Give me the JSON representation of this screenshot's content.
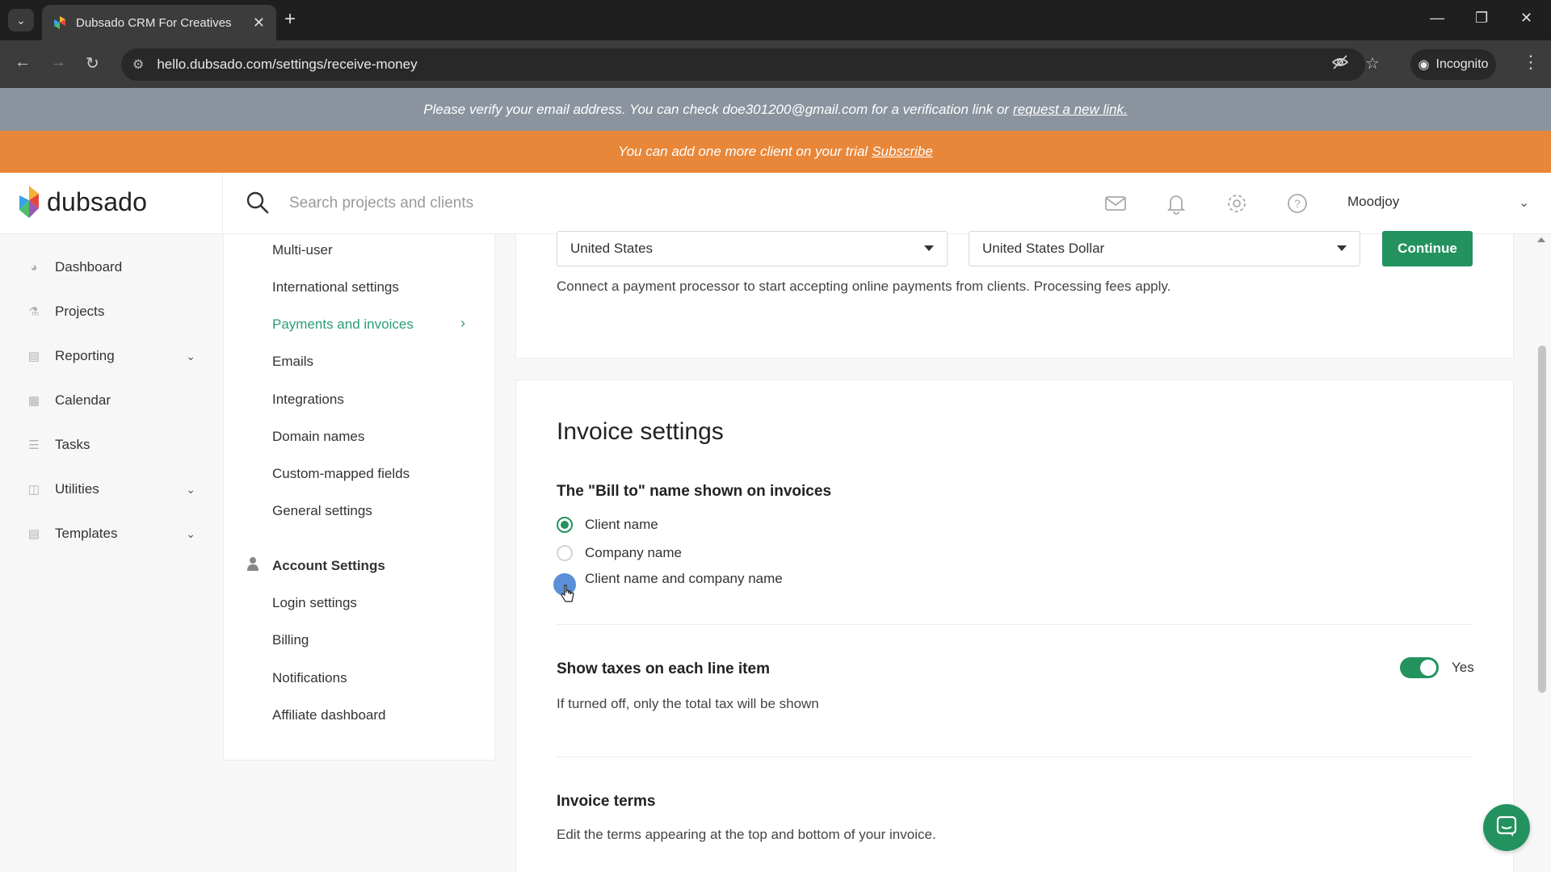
{
  "browser": {
    "tab_title": "Dubsado CRM For Creatives",
    "url": "hello.dubsado.com/settings/receive-money",
    "incognito_label": "Incognito"
  },
  "banners": {
    "verify_text": "Please verify your email address. You can check doe301200@gmail.com for a verification link or",
    "verify_link": "request a new link.",
    "trial_text": "You can add one more client on your trial",
    "trial_link": "Subscribe"
  },
  "header": {
    "logo_text": "dubsado",
    "search_placeholder": "Search projects and clients",
    "user_name": "Moodjoy"
  },
  "leftnav": {
    "items": [
      {
        "label": "Dashboard"
      },
      {
        "label": "Projects"
      },
      {
        "label": "Reporting"
      },
      {
        "label": "Calendar"
      },
      {
        "label": "Tasks"
      },
      {
        "label": "Utilities"
      },
      {
        "label": "Templates"
      }
    ]
  },
  "settings_menu": {
    "items": [
      {
        "label": "Multi-user"
      },
      {
        "label": "International settings"
      },
      {
        "label": "Payments and invoices"
      },
      {
        "label": "Emails"
      },
      {
        "label": "Integrations"
      },
      {
        "label": "Domain names"
      },
      {
        "label": "Custom-mapped fields"
      },
      {
        "label": "General settings"
      }
    ],
    "account_section": "Account Settings",
    "account_items": [
      {
        "label": "Login settings"
      },
      {
        "label": "Billing"
      },
      {
        "label": "Notifications"
      },
      {
        "label": "Affiliate dashboard"
      }
    ]
  },
  "payments": {
    "country": "United States",
    "currency": "United States Dollar",
    "continue_label": "Continue",
    "connect_text": "Connect a payment processor to start accepting online payments from clients. Processing fees apply."
  },
  "invoice_settings": {
    "title": "Invoice settings",
    "bill_to_heading": "The \"Bill to\" name shown on invoices",
    "bill_to_options": [
      {
        "label": "Client name",
        "selected": true
      },
      {
        "label": "Company name",
        "selected": false
      },
      {
        "label": "Client name and company name",
        "selected": false
      }
    ],
    "taxes_heading": "Show taxes on each line item",
    "taxes_description": "If turned off, only the total tax will be shown",
    "taxes_toggle_label": "Yes",
    "taxes_enabled": true,
    "terms_heading": "Invoice terms",
    "terms_description": "Edit the terms appearing at the top and bottom of your invoice."
  },
  "colors": {
    "accent": "#23925f",
    "trial_banner": "#e8873a",
    "verify_banner": "#8b949e"
  }
}
